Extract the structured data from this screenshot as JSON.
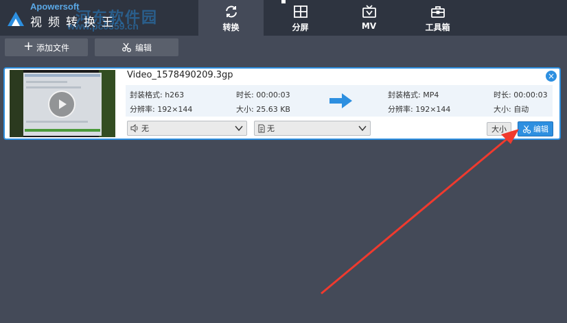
{
  "header": {
    "brand_sub": "Apowersoft",
    "brand_title": "视频转换王",
    "watermark": "河东软件园",
    "watermark_url": "www.pc0359.cn",
    "tabs": [
      {
        "label": "转换",
        "icon": "refresh-icon",
        "active": true
      },
      {
        "label": "分屏",
        "icon": "split-screen-icon",
        "active": false
      },
      {
        "label": "MV",
        "icon": "tv-icon",
        "active": false
      },
      {
        "label": "工具箱",
        "icon": "toolbox-icon",
        "active": false
      }
    ]
  },
  "toolbar": {
    "add_label": "添加文件",
    "edit_label": "编辑"
  },
  "file": {
    "name": "Video_1578490209.3gp",
    "source": {
      "format": "封装格式: h263",
      "resolution": "分辨率: 192×144",
      "duration": "时长: 00:00:03",
      "size": "大小: 25.63 KB"
    },
    "output": {
      "format": "封装格式: MP4",
      "resolution": "分辨率: 192×144",
      "duration": "时长: 00:00:03",
      "size": "大小: 自动"
    },
    "audio_select": "无",
    "subtitle_select": "无",
    "size_button": "大小",
    "edit_button": "编辑"
  },
  "colors": {
    "background": "#444a58",
    "header": "#2e3440",
    "accent": "#2d8fe0",
    "annotation": "#f03a2e"
  }
}
